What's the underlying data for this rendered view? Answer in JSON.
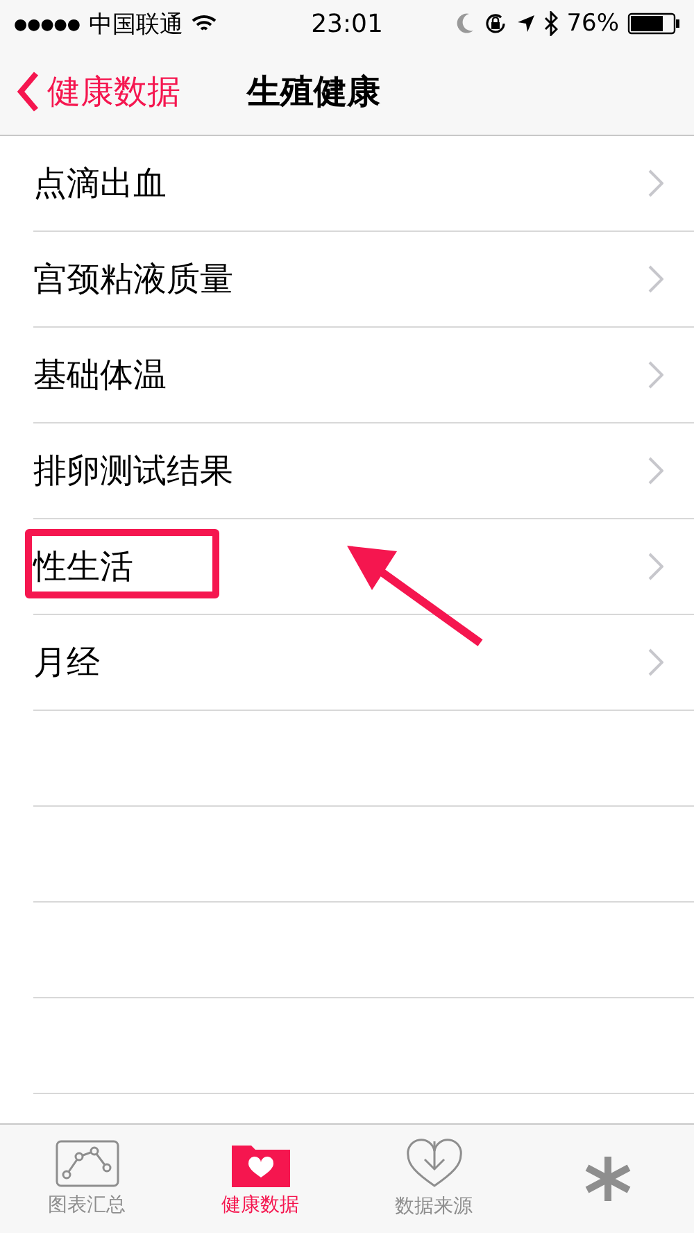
{
  "status_bar": {
    "signal_dots": "●●●●●",
    "carrier": "中国联通",
    "time": "23:01",
    "battery": "76%"
  },
  "nav": {
    "back_label": "健康数据",
    "title": "生殖健康"
  },
  "rows": [
    {
      "label": "点滴出血",
      "highlighted": false
    },
    {
      "label": "宫颈粘液质量",
      "highlighted": false
    },
    {
      "label": "基础体温",
      "highlighted": false
    },
    {
      "label": "排卵测试结果",
      "highlighted": false
    },
    {
      "label": "性生活",
      "highlighted": true
    },
    {
      "label": "月经",
      "highlighted": false
    }
  ],
  "tabs": [
    {
      "kind": "chart",
      "label": "图表汇总",
      "selected": false
    },
    {
      "kind": "health",
      "label": "健康数据",
      "selected": true
    },
    {
      "kind": "sources",
      "label": "数据来源",
      "selected": false
    },
    {
      "kind": "medical",
      "selected": false
    }
  ]
}
